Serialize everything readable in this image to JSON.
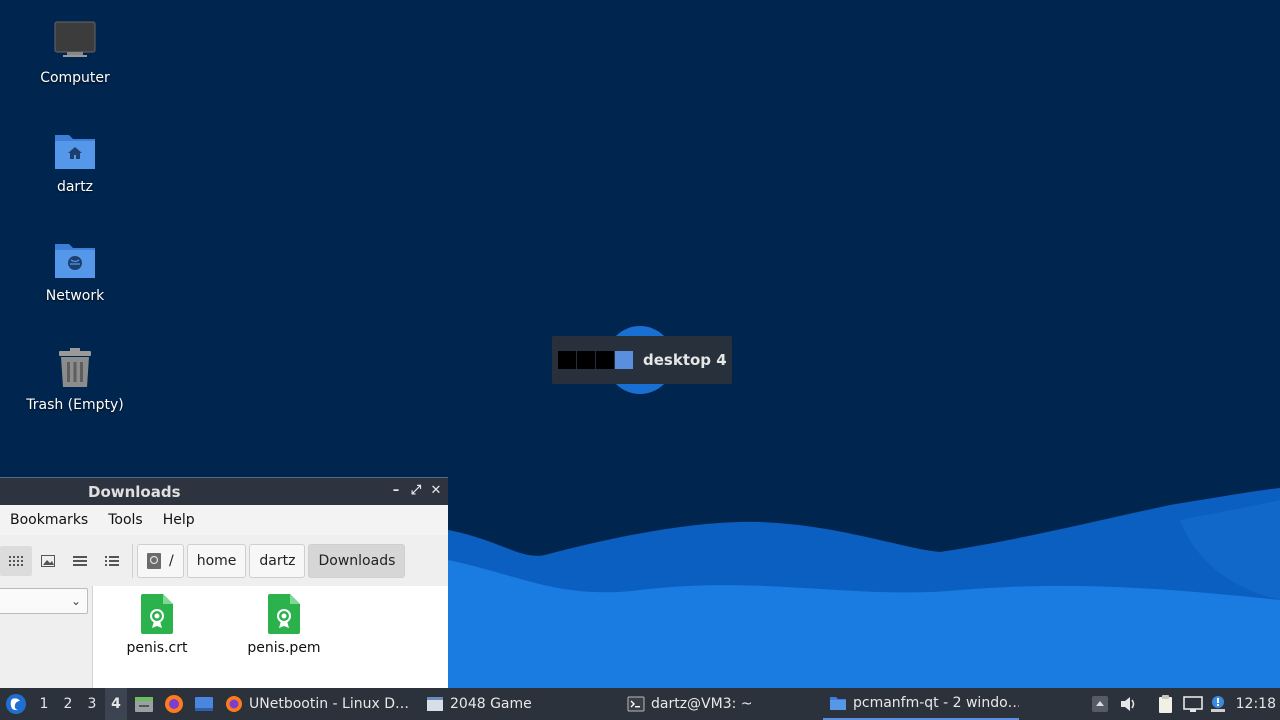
{
  "desktop": {
    "icons": [
      {
        "label": "Computer",
        "icon": "computer-icon"
      },
      {
        "label": "dartz",
        "icon": "home-folder-icon"
      },
      {
        "label": "Network",
        "icon": "network-folder-icon"
      },
      {
        "label": "Trash (Empty)",
        "icon": "trash-icon"
      }
    ],
    "osd": {
      "label": "desktop 4",
      "active_desktop": 4,
      "desktop_count": 4
    }
  },
  "file_manager": {
    "title": "Downloads",
    "window_buttons": {
      "minimize": "–",
      "maximize": "⤢",
      "close": "✕"
    },
    "menu": [
      "Bookmarks",
      "Tools",
      "Help"
    ],
    "view_buttons": [
      "icon-view-icon",
      "thumbnail-view-icon",
      "compact-view-icon",
      "detailed-list-icon"
    ],
    "path": {
      "root_label": "/",
      "segments": [
        "home",
        "dartz",
        "Downloads"
      ]
    },
    "sidebar_select_arrow": "⌄",
    "files": [
      {
        "name": "penis.crt",
        "icon": "certificate-file-icon"
      },
      {
        "name": "penis.pem",
        "icon": "certificate-file-icon"
      }
    ]
  },
  "taskbar": {
    "workspaces": [
      "1",
      "2",
      "3",
      "4"
    ],
    "active_workspace": "4",
    "tasks": [
      {
        "label": "UNetbootin - Linux D…",
        "icon": "firefox-icon"
      },
      {
        "label": "2048 Game",
        "icon": "window-icon"
      },
      {
        "label": "dartz@VM3: ~",
        "icon": "terminal-icon"
      },
      {
        "label": "pcmanfm-qt - 2 windo…",
        "icon": "folder-icon"
      }
    ],
    "clock": "12:18"
  },
  "colors": {
    "wallpaper": "#00264f",
    "wave": "#1a7be0",
    "taskbar": "#2b323c",
    "accent": "#5a8fe0"
  }
}
